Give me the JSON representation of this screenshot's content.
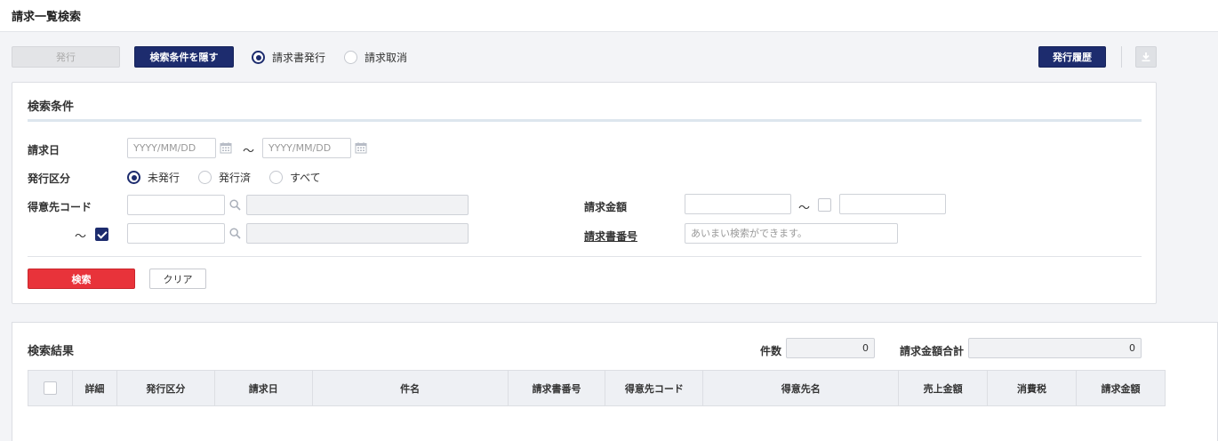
{
  "page": {
    "title": "請求一覧検索"
  },
  "toolbar": {
    "issue_label": "発行",
    "toggle_conditions_label": "検索条件を隠す",
    "mode_options": [
      "請求書発行",
      "請求取消"
    ],
    "mode_selected": 0,
    "history_label": "発行履歴",
    "download_icon": "download-icon"
  },
  "conditions": {
    "title": "検索条件",
    "invoice_date": {
      "label": "請求日",
      "from_placeholder": "YYYY/MM/DD",
      "to_placeholder": "YYYY/MM/DD",
      "separator": "～"
    },
    "issue_status": {
      "label": "発行区分",
      "options": [
        "未発行",
        "発行済",
        "すべて"
      ],
      "selected": 0
    },
    "customer_code": {
      "label": "得意先コード",
      "separator": "～"
    },
    "amount": {
      "label": "請求金額",
      "separator": "～"
    },
    "invoice_number": {
      "label": "請求書番号",
      "placeholder": "あいまい検索ができます。"
    },
    "search_label": "検索",
    "clear_label": "クリア"
  },
  "results": {
    "title": "検索結果",
    "count_label": "件数",
    "count_value": "0",
    "total_label": "請求金額合計",
    "total_value": "0",
    "columns": [
      "詳細",
      "発行区分",
      "請求日",
      "件名",
      "請求書番号",
      "得意先コード",
      "得意先名",
      "売上金額",
      "消費税",
      "請求金額"
    ]
  },
  "colors": {
    "navy": "#1d2c6e",
    "red": "#e8333a"
  }
}
